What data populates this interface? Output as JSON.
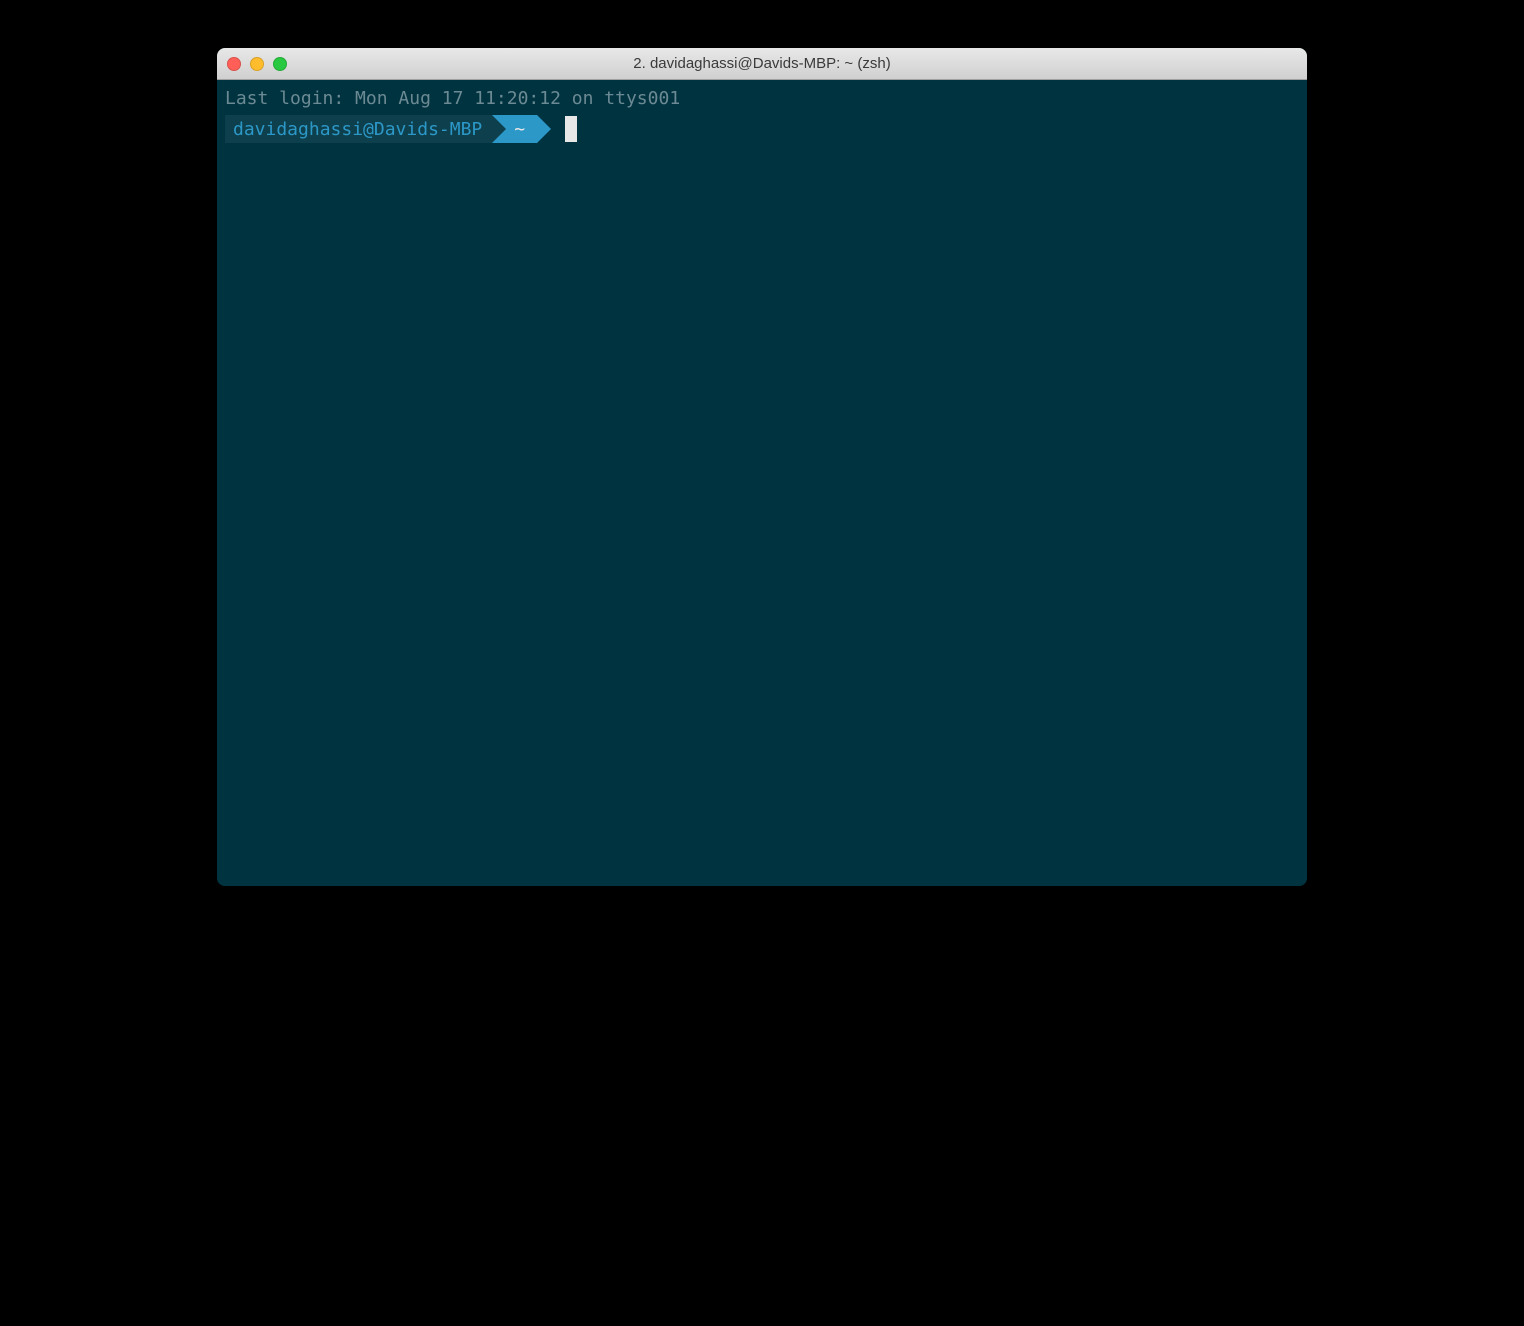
{
  "window": {
    "title": "2. davidaghassi@Davids-MBP: ~ (zsh)"
  },
  "terminal": {
    "last_login": "Last login: Mon Aug 17 11:20:12 on ttys001",
    "prompt": {
      "user_host": "davidaghassi@Davids-MBP",
      "path": "~"
    }
  },
  "colors": {
    "terminal_bg": "#003340",
    "text_muted": "#6c8a94",
    "segment_host_bg": "#0e3f4c",
    "segment_path_bg": "#2c98c8",
    "accent_text": "#2c98c8"
  }
}
